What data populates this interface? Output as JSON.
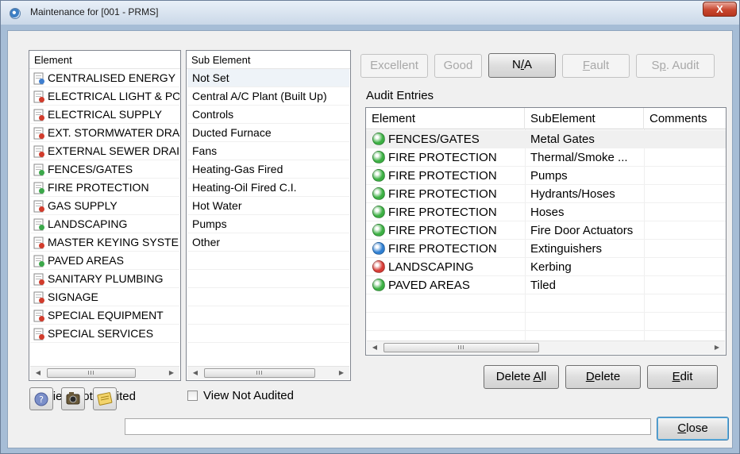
{
  "window": {
    "title": "Maintenance for [001 - PRMS]",
    "close_glyph": "X"
  },
  "elements_list": {
    "header": "Element",
    "items": [
      {
        "label": "CENTRALISED ENERGY",
        "icon": "blue-document-icon"
      },
      {
        "label": "ELECTRICAL LIGHT & POWER",
        "icon": "red-x-document-icon"
      },
      {
        "label": "ELECTRICAL SUPPLY",
        "icon": "red-x-document-icon"
      },
      {
        "label": "EXT. STORMWATER DRAINAGE",
        "icon": "red-x-document-icon"
      },
      {
        "label": "EXTERNAL SEWER DRAINAGE",
        "icon": "red-x-document-icon"
      },
      {
        "label": "FENCES/GATES",
        "icon": "green-plus-document-icon"
      },
      {
        "label": "FIRE PROTECTION",
        "icon": "green-plus-document-icon"
      },
      {
        "label": "GAS SUPPLY",
        "icon": "red-x-document-icon"
      },
      {
        "label": "LANDSCAPING",
        "icon": "green-plus-document-icon"
      },
      {
        "label": "MASTER KEYING SYSTEM",
        "icon": "red-x-document-icon"
      },
      {
        "label": "PAVED AREAS",
        "icon": "green-plus-document-icon"
      },
      {
        "label": "SANITARY PLUMBING",
        "icon": "red-x-document-icon"
      },
      {
        "label": "SIGNAGE",
        "icon": "red-x-document-icon"
      },
      {
        "label": "SPECIAL EQUIPMENT",
        "icon": "red-x-document-icon"
      },
      {
        "label": "SPECIAL SERVICES",
        "icon": "red-x-document-icon"
      }
    ],
    "scroll_thumb": "III"
  },
  "sub_elements_list": {
    "header": "Sub Element",
    "items": [
      "Not Set",
      "Central A/C Plant (Built Up)",
      "Controls",
      "Ducted Furnace",
      "Fans",
      "Heating-Gas Fired",
      "Heating-Oil Fired C.I.",
      "Hot Water",
      "Pumps",
      "Other"
    ],
    "selected_index": 0,
    "scroll_thumb": "III"
  },
  "view_not_audited_label": "View Not Audited",
  "rating_buttons": {
    "excellent": "Excellent",
    "good": "Good",
    "na_prefix": "N",
    "na_underlined": "/",
    "na_suffix": "A",
    "fault_underlined": "F",
    "fault_rest": "ault",
    "sp_audit_prefix": "S",
    "sp_audit_underlined": "p",
    "sp_audit_suffix": ". Audit"
  },
  "audit_entries": {
    "group_label": "Audit Entries",
    "columns": {
      "element": "Element",
      "subelement": "SubElement",
      "comments": "Comments"
    },
    "rows": [
      {
        "element": "FENCES/GATES",
        "subelement": "Metal Gates",
        "comments": "",
        "status_color": "#3cb043"
      },
      {
        "element": "FIRE PROTECTION",
        "subelement": "Thermal/Smoke ...",
        "comments": "",
        "status_color": "#3cb043"
      },
      {
        "element": "FIRE PROTECTION",
        "subelement": "Pumps",
        "comments": "",
        "status_color": "#3cb043"
      },
      {
        "element": "FIRE PROTECTION",
        "subelement": "Hydrants/Hoses",
        "comments": "",
        "status_color": "#3cb043"
      },
      {
        "element": "FIRE PROTECTION",
        "subelement": "Hoses",
        "comments": "",
        "status_color": "#3cb043"
      },
      {
        "element": "FIRE PROTECTION",
        "subelement": "Fire Door Actuators",
        "comments": "",
        "status_color": "#3cb043"
      },
      {
        "element": "FIRE PROTECTION",
        "subelement": "Extinguishers",
        "comments": "",
        "status_color": "#2f7fd2"
      },
      {
        "element": "LANDSCAPING",
        "subelement": "Kerbing",
        "comments": "",
        "status_color": "#d63b35"
      },
      {
        "element": "PAVED AREAS",
        "subelement": "Tiled",
        "comments": "",
        "status_color": "#3cb043"
      }
    ],
    "selected_index": 0,
    "scroll_thumb": "III"
  },
  "action_buttons": {
    "delete_all_prefix": "Delete ",
    "delete_all_underlined": "A",
    "delete_all_suffix": "ll",
    "delete_underlined": "D",
    "delete_rest": "elete",
    "edit_underlined": "E",
    "edit_rest": "dit",
    "close_underlined": "C",
    "close_rest": "lose"
  },
  "toolbar": {
    "icons": [
      "help-icon",
      "camera-icon",
      "notes-icon"
    ]
  }
}
